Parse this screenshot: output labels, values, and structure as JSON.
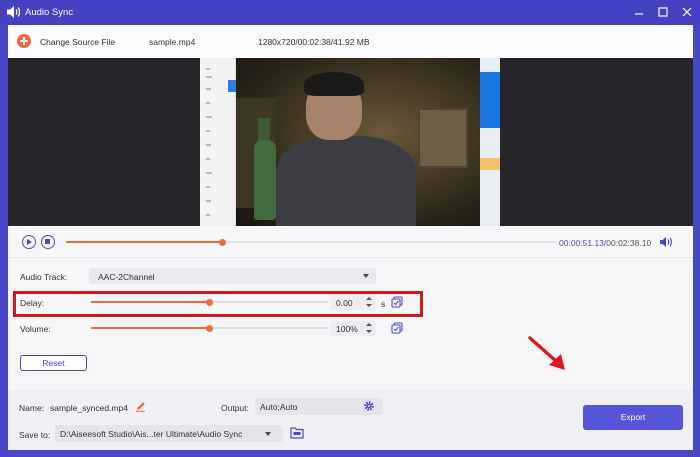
{
  "window": {
    "title": "Audio Sync",
    "app_icon": "speaker-icon",
    "controls": [
      "minimize-icon",
      "maximize-icon",
      "close-icon"
    ]
  },
  "file_bar": {
    "change_source_label": "Change Source File",
    "file_name": "sample.mp4",
    "file_info": "1280x720/00:02:38/41.92 MB"
  },
  "playback": {
    "current_time": "00:00:51.13",
    "total_time": "/00:02:38.10",
    "progress_fraction": 0.32,
    "play_icon": "play-icon",
    "stop_icon": "stop-icon",
    "volume_icon": "volume-icon"
  },
  "settings": {
    "audio_track_label": "Audio Track:",
    "audio_track_value": "AAC-2Channel",
    "delay_label": "Delay:",
    "delay_value": "0.00",
    "delay_unit": "s",
    "delay_slider_fraction": 0.5,
    "volume_label": "Volume:",
    "volume_value": "100%",
    "volume_slider_fraction": 0.5,
    "reset_label": "Reset"
  },
  "output": {
    "name_label": "Name:",
    "name_value": "sample_synced.mp4",
    "output_label": "Output:",
    "output_value": "Auto;Auto",
    "save_to_label": "Save to:",
    "save_to_value": "D:\\Aiseesoft Studio\\Ais...ter Ultimate\\Audio Sync",
    "export_label": "Export"
  },
  "colors": {
    "accent": "#4a48c8",
    "slider": "#f06a3a",
    "highlight": "#d4191e"
  }
}
